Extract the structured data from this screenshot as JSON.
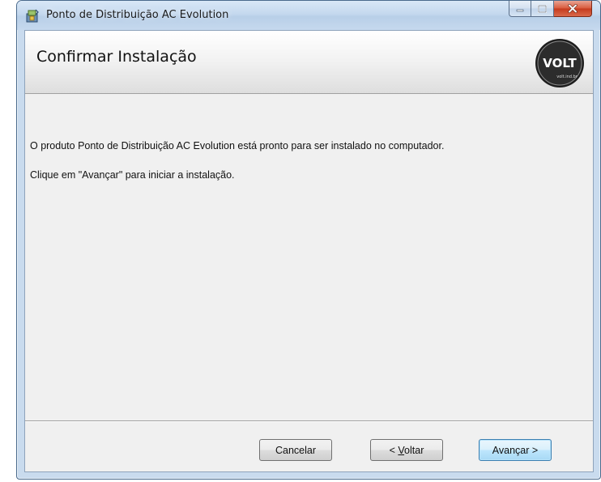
{
  "window": {
    "title": "Ponto de Distribuição AC Evolution"
  },
  "banner": {
    "title": "Confirmar Instalação",
    "logo_text": "VOLT",
    "logo_subtext": "volt.ind.br"
  },
  "body": {
    "message_1": "O produto Ponto de Distribuição AC Evolution está pronto para ser instalado no computador.",
    "message_2": "Clique em \"Avançar\" para iniciar a instalação."
  },
  "buttons": {
    "cancel_label": "Cancelar",
    "back_prefix": "< ",
    "back_access_key": "V",
    "back_rest": "oltar",
    "next_label": "Avançar >"
  },
  "colors": {
    "title_bar": "#c4d8ee",
    "close_button": "#c53a1d",
    "default_button_border": "#3c7fb1"
  },
  "icons": {
    "app": "installer-icon",
    "minimize": "minimize-icon",
    "maximize": "maximize-icon",
    "close": "close-icon"
  }
}
